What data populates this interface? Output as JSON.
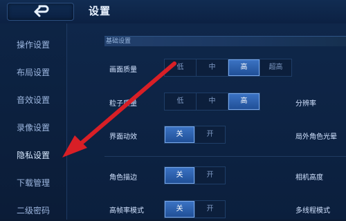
{
  "header": {
    "title": "设置"
  },
  "sidebar": {
    "items": [
      {
        "label": "操作设置"
      },
      {
        "label": "布局设置"
      },
      {
        "label": "音效设置"
      },
      {
        "label": "录像设置"
      },
      {
        "label": "隐私设置"
      },
      {
        "label": "下载管理"
      },
      {
        "label": "二级密码"
      }
    ]
  },
  "main": {
    "section_title": "基础设置",
    "rows": [
      {
        "label": "画面质量",
        "options": [
          "低",
          "中",
          "高",
          "超高"
        ],
        "selected": "高"
      },
      {
        "label": "粒子质量",
        "options": [
          "低",
          "中",
          "高"
        ],
        "selected": "高",
        "right_label": "分辨率"
      },
      {
        "label": "界面动效",
        "options": [
          "关",
          "开"
        ],
        "selected": "关",
        "right_label": "局外角色光晕"
      },
      {
        "label": "角色描边",
        "options": [
          "关",
          "开"
        ],
        "selected": "关",
        "right_label": "相机高度"
      },
      {
        "label": "高帧率模式",
        "options": [
          "关",
          "开"
        ],
        "selected": "关",
        "right_label": "多线程模式"
      }
    ]
  },
  "colors": {
    "accent": "#2f66b8",
    "arrow": "#d81f26",
    "background": "#0b1a33"
  }
}
